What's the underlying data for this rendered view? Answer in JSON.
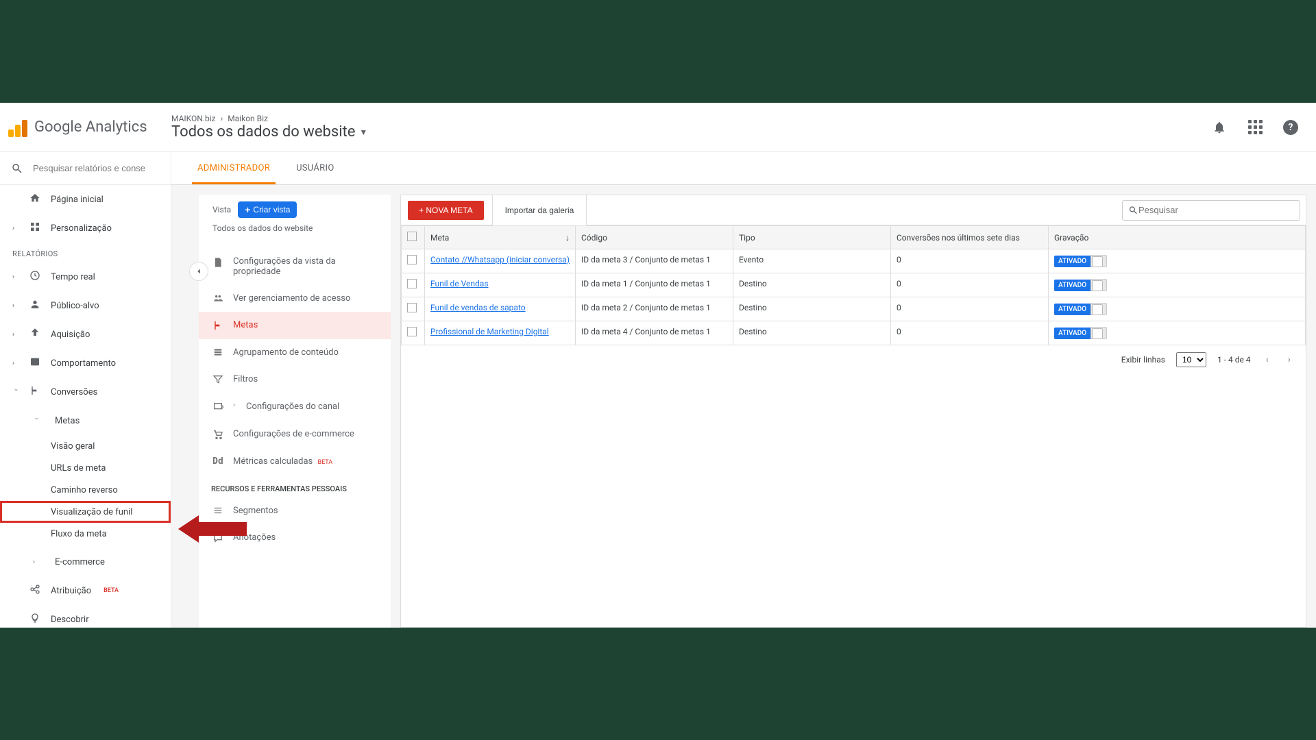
{
  "product": "Google Analytics",
  "breadcrumb": {
    "account": "MAIKON.biz",
    "property": "Maikon Biz"
  },
  "view_title": "Todos os dados do website",
  "search_placeholder": "Pesquisar relatórios e conse",
  "nav": {
    "home": "Página inicial",
    "custom": "Personalização",
    "section": "RELATÓRIOS",
    "realtime": "Tempo real",
    "audience": "Público-alvo",
    "acquisition": "Aquisição",
    "behavior": "Comportamento",
    "conversions": "Conversões",
    "goals_label": "Metas",
    "goals_sub": {
      "overview": "Visão geral",
      "goal_urls": "URLs de meta",
      "reverse": "Caminho reverso",
      "funnel": "Visualização de funil",
      "flow": "Fluxo da meta"
    },
    "ecommerce": "E-commerce",
    "attribution": "Atribuição",
    "beta": "BETA",
    "discover": "Descobrir"
  },
  "tabs": {
    "admin": "ADMINISTRADOR",
    "user": "USUÁRIO"
  },
  "admin_col": {
    "vista": "Vista",
    "create": "Criar vista",
    "subtitle": "Todos os dados do website",
    "items": {
      "view_settings": "Configurações da vista da propriedade",
      "access_mgmt": "Ver gerenciamento de acesso",
      "goals": "Metas",
      "content_grouping": "Agrupamento de conteúdo",
      "filters": "Filtros",
      "channel_settings": "Configurações do canal",
      "ecommerce_settings": "Configurações de e-commerce",
      "calc_metrics": "Métricas calculadas",
      "beta": "BETA"
    },
    "section2": "RECURSOS E FERRAMENTAS PESSOAIS",
    "segments": "Segmentos",
    "annotations": "Anotações"
  },
  "panel": {
    "new": "+ NOVA META",
    "import": "Importar da galeria",
    "search_ph": "Pesquisar",
    "headers": {
      "meta": "Meta",
      "codigo": "Código",
      "tipo": "Tipo",
      "conv": "Conversões nos últimos sete dias",
      "grav": "Gravação"
    },
    "rows": [
      {
        "meta": "Contato //Whatsapp (iniciar conversa)",
        "codigo": "ID da meta 3 / Conjunto de metas 1",
        "tipo": "Evento",
        "conv": "0",
        "toggle": "ATIVADO"
      },
      {
        "meta": "Funil de Vendas",
        "codigo": "ID da meta 1 / Conjunto de metas 1",
        "tipo": "Destino",
        "conv": "0",
        "toggle": "ATIVADO"
      },
      {
        "meta": "Funil de vendas de sapato",
        "codigo": "ID da meta 2 / Conjunto de metas 1",
        "tipo": "Destino",
        "conv": "0",
        "toggle": "ATIVADO"
      },
      {
        "meta": "Profissional de Marketing Digital",
        "codigo": "ID da meta 4 / Conjunto de metas 1",
        "tipo": "Destino",
        "conv": "0",
        "toggle": "ATIVADO"
      }
    ],
    "pager": {
      "label": "Exibir linhas",
      "per": "10",
      "range": "1 - 4 de 4"
    }
  }
}
